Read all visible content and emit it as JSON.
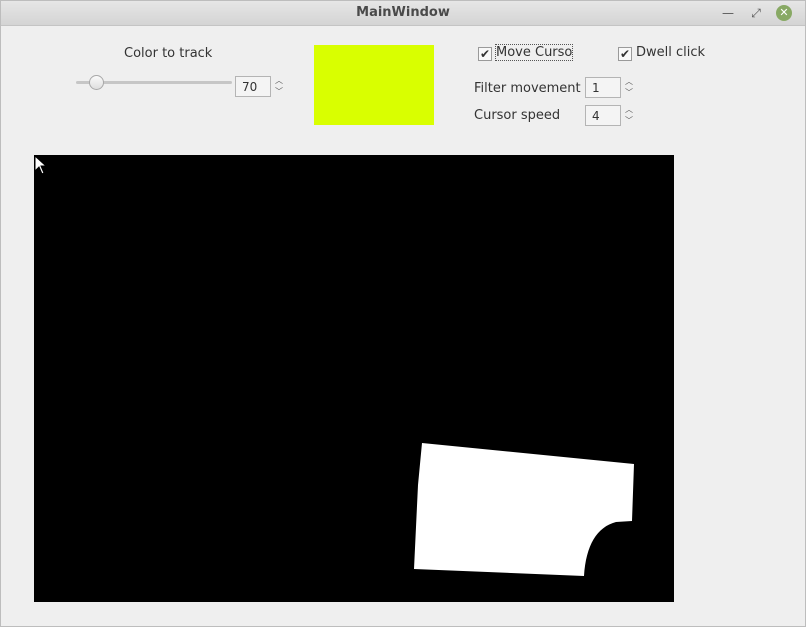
{
  "window": {
    "title": "MainWindow"
  },
  "controls": {
    "color_label": "Color to track",
    "slider_value": 70,
    "threshold_spin": "70",
    "swatch_color": "#d9ff00",
    "move_cursor_label": "Move Cursor",
    "move_cursor_checked": true,
    "dwell_click_label": "Dwell click",
    "dwell_click_checked": true,
    "filter_label": "Filter movement",
    "filter_value": "1",
    "speed_label": "Cursor speed",
    "speed_value": "4"
  },
  "icons": {
    "minimize": "minimize-icon",
    "maximize": "maximize-icon",
    "close": "close-icon",
    "checkmark": "✔"
  },
  "preview": {
    "background": "#000000",
    "mask_color": "#ffffff"
  }
}
